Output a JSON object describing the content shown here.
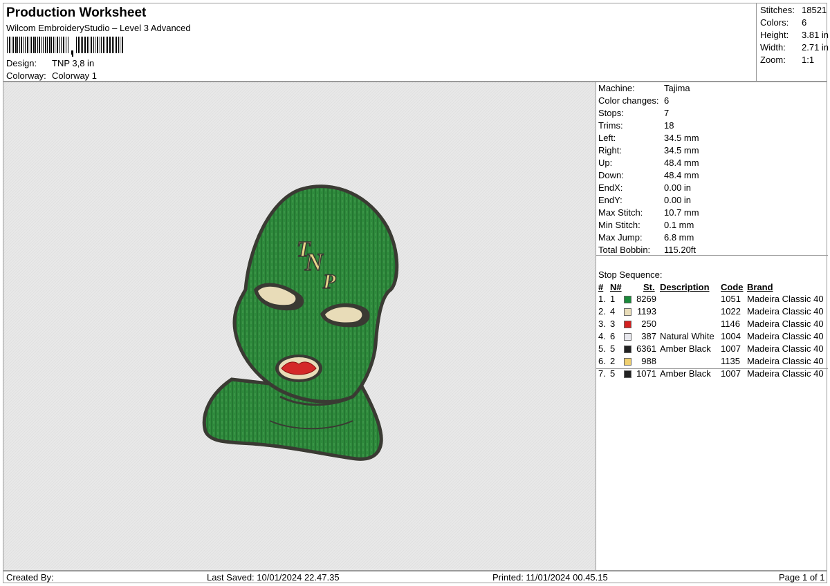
{
  "header": {
    "title": "Production Worksheet",
    "subtitle": "Wilcom EmbroideryStudio – Level 3 Advanced",
    "design_label": "Design:",
    "design_value": "TNP 3,8 in",
    "colorway_label": "Colorway:",
    "colorway_value": "Colorway 1"
  },
  "summary": {
    "stitches_label": "Stitches:",
    "stitches_value": "18521",
    "colors_label": "Colors:",
    "colors_value": "6",
    "height_label": "Height:",
    "height_value": "3.81 in",
    "width_label": "Width:",
    "width_value": "2.71 in",
    "zoom_label": "Zoom:",
    "zoom_value": "1:1"
  },
  "machine_info": [
    {
      "label": "Machine:",
      "value": "Tajima"
    },
    {
      "label": "Color changes:",
      "value": "6"
    },
    {
      "label": "Stops:",
      "value": "7"
    },
    {
      "label": "Trims:",
      "value": "18"
    },
    {
      "label": "Left:",
      "value": "34.5 mm"
    },
    {
      "label": "Right:",
      "value": "34.5 mm"
    },
    {
      "label": "Up:",
      "value": "48.4 mm"
    },
    {
      "label": "Down:",
      "value": "48.4 mm"
    },
    {
      "label": "EndX:",
      "value": "0.00 in"
    },
    {
      "label": "EndY:",
      "value": "0.00 in"
    },
    {
      "label": "Max Stitch:",
      "value": "10.7 mm"
    },
    {
      "label": "Min Stitch:",
      "value": "0.1 mm"
    },
    {
      "label": "Max Jump:",
      "value": "6.8 mm"
    },
    {
      "label": "Total Bobbin:",
      "value": "115.20ft"
    }
  ],
  "stop_sequence": {
    "heading": "Stop Sequence:",
    "columns": {
      "num": "#",
      "n": "N#",
      "st": "St.",
      "description": "Description",
      "code": "Code",
      "brand": "Brand"
    },
    "rows": [
      {
        "num": "1.",
        "n": "1",
        "color": "#1a8a3a",
        "st": "8269",
        "description": "",
        "code": "1051",
        "brand": "Madeira Classic 40"
      },
      {
        "num": "2.",
        "n": "4",
        "color": "#e8dcb8",
        "st": "1193",
        "description": "",
        "code": "1022",
        "brand": "Madeira Classic 40"
      },
      {
        "num": "3.",
        "n": "3",
        "color": "#d42020",
        "st": "250",
        "description": "",
        "code": "1146",
        "brand": "Madeira Classic 40"
      },
      {
        "num": "4.",
        "n": "6",
        "color": "#e8e8ee",
        "st": "387",
        "description": "Natural White",
        "code": "1004",
        "brand": "Madeira Classic 40"
      },
      {
        "num": "5.",
        "n": "5",
        "color": "#222222",
        "st": "6361",
        "description": "Amber Black",
        "code": "1007",
        "brand": "Madeira Classic 40"
      },
      {
        "num": "6.",
        "n": "2",
        "color": "#f0d070",
        "st": "988",
        "description": "",
        "code": "1135",
        "brand": "Madeira Classic 40"
      },
      {
        "num": "7.",
        "n": "5",
        "color": "#222222",
        "st": "1071",
        "description": "Amber Black",
        "code": "1007",
        "brand": "Madeira Classic 40"
      }
    ]
  },
  "design_artwork": {
    "monogram": "TNP",
    "mask_color": "#2e8a3c",
    "outline_color": "#3a3a33",
    "lip_color": "#d42828",
    "eye_color": "#e8dcb8"
  },
  "footer": {
    "created_by": "Created By:",
    "last_saved": "Last Saved: 10/01/2024 22.47.35",
    "printed": "Printed: 11/01/2024 00.45.15",
    "page": "Page 1 of 1"
  }
}
